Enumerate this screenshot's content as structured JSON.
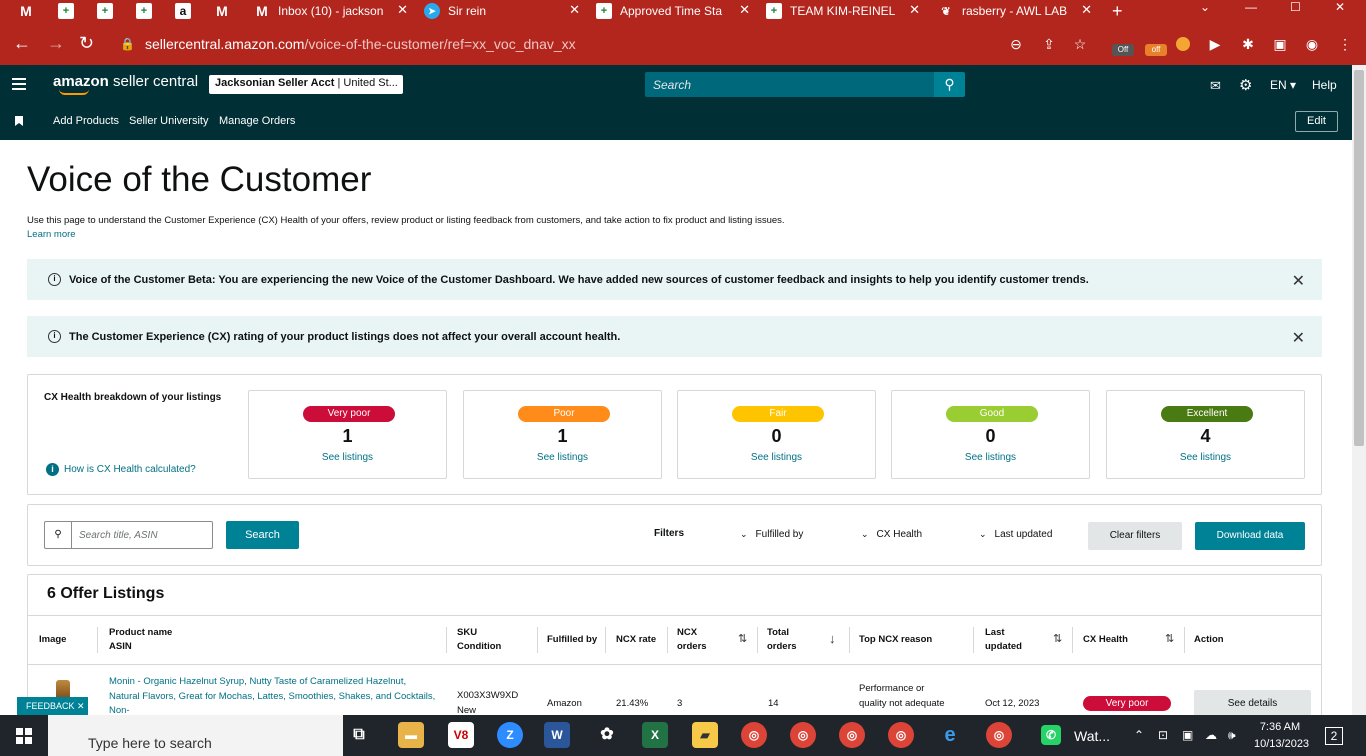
{
  "browser": {
    "tabs": [
      {
        "icon": "gmail-icon",
        "label": "",
        "glyph": "M"
      },
      {
        "icon": "sheets-icon",
        "label": "",
        "glyph": "+"
      },
      {
        "icon": "sheets-icon",
        "label": "",
        "glyph": "+"
      },
      {
        "icon": "sheets-icon",
        "label": "",
        "glyph": "+"
      },
      {
        "icon": "amazon-icon",
        "label": "",
        "glyph": "a"
      },
      {
        "icon": "gmail-icon",
        "label": "",
        "glyph": "M"
      },
      {
        "icon": "gmail-icon",
        "label": "Inbox (10) - jackson",
        "glyph": "M"
      },
      {
        "icon": "telegram-icon",
        "label": "Sir rein",
        "glyph": "➤"
      },
      {
        "icon": "sheets-icon",
        "label": "Approved Time Sta",
        "glyph": "+"
      },
      {
        "icon": "sheets-icon",
        "label": "TEAM KIM-REINEL",
        "glyph": "+"
      },
      {
        "icon": "raspberry-icon",
        "label": "rasberry - AWL LAB",
        "glyph": "❦"
      }
    ],
    "new_tab": "+",
    "url_host": "sellercentral.amazon.com",
    "url_path": "/voice-of-the-customer/ref=xx_voc_dnav_xx",
    "ext_badge_1": "Off",
    "ext_badge_2": "off"
  },
  "seller_central": {
    "logo_bold": "amazon",
    "logo_rest": " seller central",
    "account_bold": "Jacksonian Seller Acct",
    "account_rest": " | United St...",
    "search_placeholder": "Search",
    "language": "EN",
    "help": "Help",
    "nav_links": [
      "Add Products",
      "Seller University",
      "Manage Orders"
    ],
    "edit": "Edit"
  },
  "page": {
    "title": "Voice of the Customer",
    "description": "Use this page to understand the Customer Experience (CX) Health of your offers, review product or listing feedback from customers, and take action to fix product and listing issues.",
    "learn_more": "Learn more",
    "banner1": "Voice of the Customer Beta: You are experiencing the new Voice of the Customer Dashboard. We have added new sources of customer feedback and insights to help you identify customer trends.",
    "banner2": "The Customer Experience (CX) rating of your product listings does not affect your overall account health.",
    "cx_breakdown_label": "CX Health breakdown of your listings",
    "how_cx": "How is CX Health calculated?",
    "cx_cards": [
      {
        "label": "Very poor",
        "count": "1",
        "link": "See listings",
        "color": "#cc0c39"
      },
      {
        "label": "Poor",
        "count": "1",
        "link": "See listings",
        "color": "#ff8c1a"
      },
      {
        "label": "Fair",
        "count": "0",
        "link": "See listings",
        "color": "#ffc400"
      },
      {
        "label": "Good",
        "count": "0",
        "link": "See listings",
        "color": "#9acd32"
      },
      {
        "label": "Excellent",
        "count": "4",
        "link": "See listings",
        "color": "#4a7a12"
      }
    ],
    "search_placeholder": "Search title, ASIN",
    "search_button": "Search",
    "filters_label": "Filters",
    "filter_fulfilled": "Fulfilled by",
    "filter_cx": "CX Health",
    "filter_updated": "Last updated",
    "clear_filters": "Clear filters",
    "download": "Download data",
    "listings_title": "6 Offer Listings",
    "headers": {
      "image": "Image",
      "product_name": "Product name",
      "asin": "ASIN",
      "sku": "SKU",
      "condition": "Condition",
      "fulfilled_by": "Fulfilled by",
      "ncx_rate": "NCX rate",
      "ncx_orders_1": "NCX",
      "ncx_orders_2": "orders",
      "total_orders_1": "Total",
      "total_orders_2": "orders",
      "top_ncx": "Top NCX reason",
      "last_updated_1": "Last",
      "last_updated_2": "updated",
      "cx_health": "CX Health",
      "action": "Action"
    },
    "row": {
      "product": "Monin - Organic Hazelnut Syrup, Nutty Taste of Caramelized Hazelnut, Natural Flavors, Great for Mochas, Lattes, Smoothies, Shakes, and Cocktails, Non-",
      "sku": "X003X3W9XD",
      "condition": "New",
      "fulfilled_by": "Amazon",
      "ncx_rate": "21.43%",
      "ncx_orders": "3",
      "total_orders": "14",
      "reason_1": "Performance or",
      "reason_2": "quality not adequate",
      "last_updated": "Oct 12, 2023",
      "cx_health": "Very poor",
      "action": "See details"
    },
    "feedback": "FEEDBACK ✕"
  },
  "taskbar": {
    "search": "Type here to search",
    "time": "7:36 AM",
    "date": "10/13/2023",
    "wa_label": "Wat...",
    "notif": "2"
  }
}
